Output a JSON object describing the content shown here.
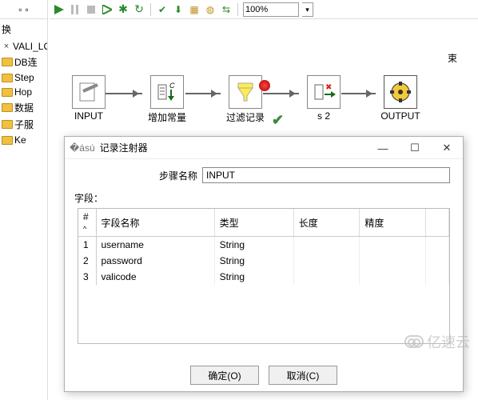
{
  "toolbar": {
    "zoom": "100%"
  },
  "tree": {
    "tab": "换",
    "items": [
      "VALI_LO",
      "DB连",
      "Step",
      "Hop",
      "数据",
      "子服",
      "Ke"
    ]
  },
  "steps": {
    "input": "INPUT",
    "add_const": "增加常量",
    "filter": "过滤记录",
    "s2": "s 2",
    "output": "OUTPUT"
  },
  "canvas": {
    "side_label": "束"
  },
  "dialog": {
    "title": "记录注射器",
    "step_name_label": "步骤名称",
    "step_name_value": "INPUT",
    "fields_label": "字段：",
    "columns": {
      "idx": "#",
      "name": "字段名称",
      "type": "类型",
      "length": "长度",
      "precision": "精度"
    },
    "rows": [
      {
        "idx": "1",
        "name": "username",
        "type": "String",
        "length": "",
        "precision": ""
      },
      {
        "idx": "2",
        "name": "password",
        "type": "String",
        "length": "",
        "precision": ""
      },
      {
        "idx": "3",
        "name": "valicode",
        "type": "String",
        "length": "",
        "precision": ""
      }
    ],
    "ok": "确定(O)",
    "cancel": "取消(C)"
  },
  "watermark": "亿速云"
}
